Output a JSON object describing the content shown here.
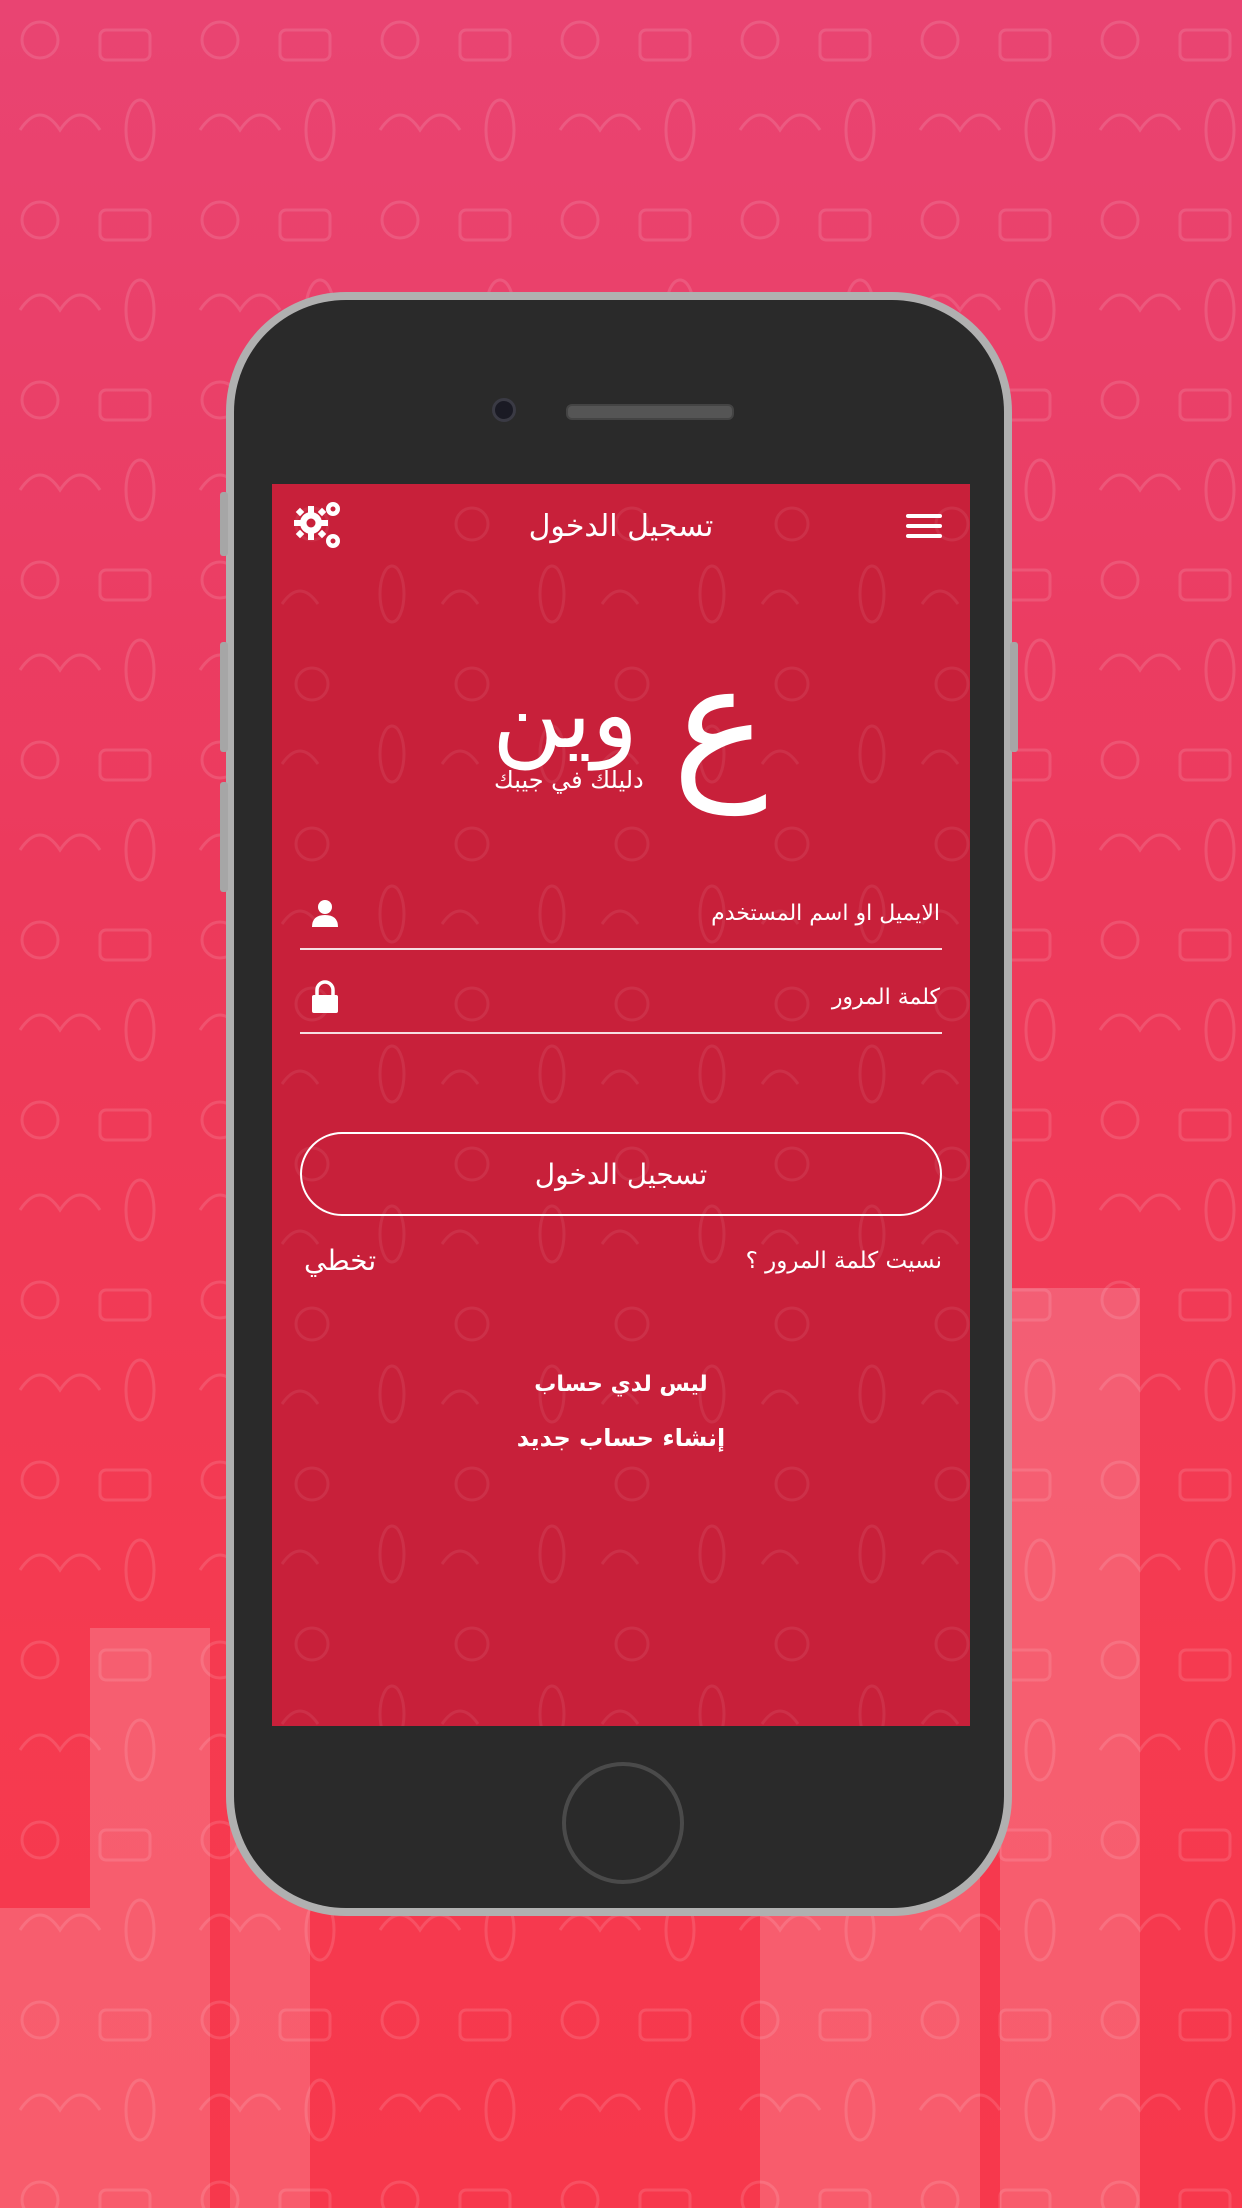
{
  "header": {
    "title": "تسجيل الدخول",
    "settings_icon": "gears-icon",
    "menu_icon": "hamburger-menu-icon"
  },
  "logo": {
    "word": "وين",
    "letter": "ع",
    "tagline": "دليلك في جيبك"
  },
  "form": {
    "username_placeholder": "الايميل او اسم المستخدم",
    "password_placeholder": "كلمة المرور",
    "login_label": "تسجيل الدخول",
    "forgot_label": "نسيت كلمة المرور ؟",
    "skip_label": "تخطي"
  },
  "signup": {
    "no_account_text": "ليس لدي حساب",
    "create_label": "إنشاء حساب جديد"
  },
  "colors": {
    "screen_bg": "#c8203a",
    "page_bg": "#ec3a5c"
  }
}
